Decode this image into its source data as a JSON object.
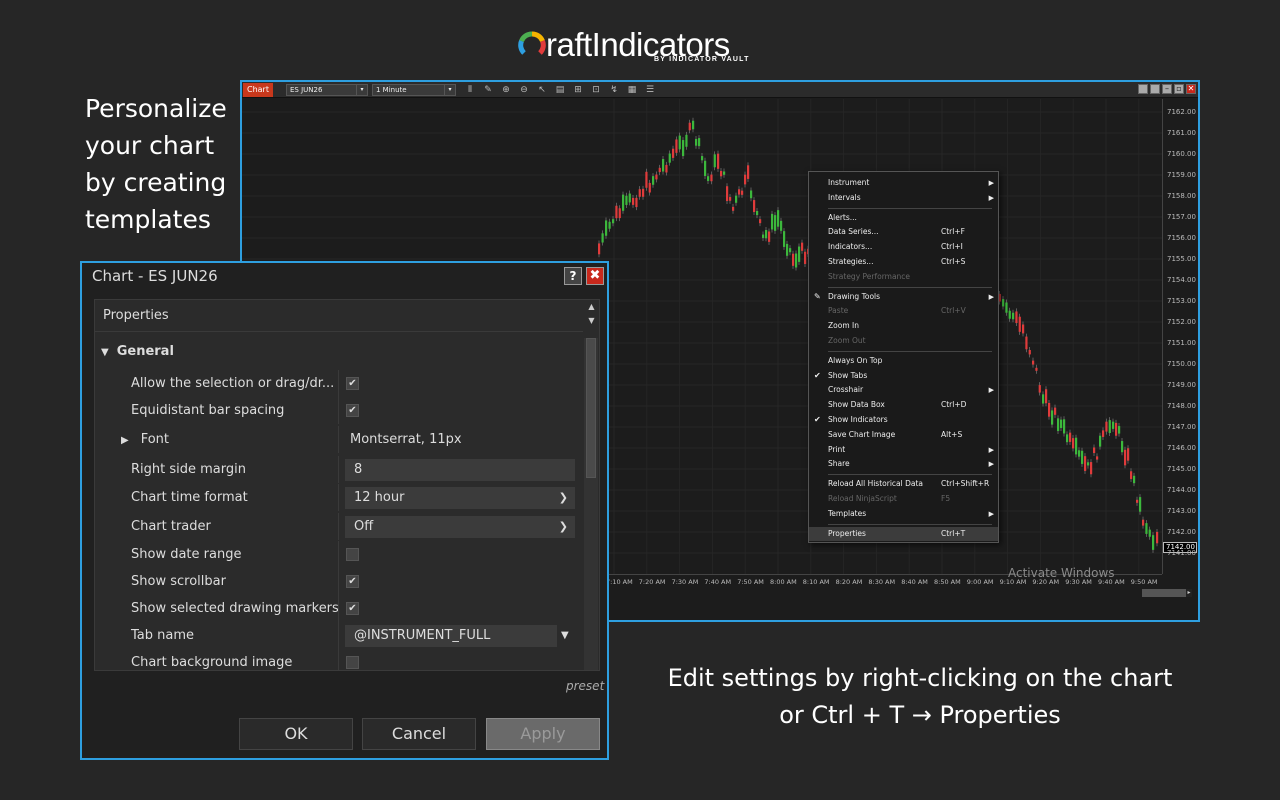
{
  "logo": {
    "text": "raftIndicators",
    "sub": "BY INDICATOR VAULT"
  },
  "captions": {
    "left": [
      "Personalize",
      "your chart",
      "by creating",
      "templates"
    ],
    "right_line1": "Edit settings by right-clicking on the chart",
    "right_line2": "or Ctrl + T → Properties"
  },
  "chart": {
    "tab_label": "Chart",
    "instrument": "ES JUN26",
    "interval": "1 Minute",
    "prices": [
      "7162.00",
      "7161.00",
      "7160.00",
      "7159.00",
      "7158.00",
      "7157.00",
      "7156.00",
      "7155.00",
      "7154.00",
      "7153.00",
      "7152.00",
      "7151.00",
      "7150.00",
      "7149.00",
      "7148.00",
      "7147.00",
      "7146.00",
      "7145.00",
      "7144.00",
      "7143.00",
      "7142.00",
      "7141.00"
    ],
    "current_price": "7142.00",
    "times": [
      "7:10 AM",
      "7:20 AM",
      "7:30 AM",
      "7:40 AM",
      "7:50 AM",
      "8:00 AM",
      "8:10 AM",
      "8:20 AM",
      "8:30 AM",
      "8:40 AM",
      "8:50 AM",
      "9:00 AM",
      "9:10 AM",
      "9:20 AM",
      "9:30 AM",
      "9:40 AM",
      "9:50 AM"
    ],
    "watermark": "Activate Windows",
    "colors": {
      "up": "#3cb83c",
      "down": "#e03b3b",
      "accent": "#2e9fe0"
    }
  },
  "context_menu": {
    "items": [
      {
        "label": "Instrument",
        "submenu": true
      },
      {
        "label": "Intervals",
        "submenu": true
      },
      {
        "sep": true
      },
      {
        "label": "Alerts..."
      },
      {
        "label": "Data Series...",
        "shortcut": "Ctrl+F"
      },
      {
        "label": "Indicators...",
        "shortcut": "Ctrl+I"
      },
      {
        "label": "Strategies...",
        "shortcut": "Ctrl+S"
      },
      {
        "label": "Strategy Performance",
        "disabled": true
      },
      {
        "sep": true
      },
      {
        "label": "Drawing Tools",
        "submenu": true,
        "icon": "pencil-icon"
      },
      {
        "label": "Paste",
        "shortcut": "Ctrl+V",
        "disabled": true
      },
      {
        "label": "Zoom In"
      },
      {
        "label": "Zoom Out",
        "disabled": true
      },
      {
        "sep": true
      },
      {
        "label": "Always On Top"
      },
      {
        "label": "Show Tabs",
        "checked": true
      },
      {
        "label": "Crosshair",
        "submenu": true
      },
      {
        "label": "Show Data Box",
        "shortcut": "Ctrl+D"
      },
      {
        "label": "Show Indicators",
        "checked": true
      },
      {
        "label": "Save Chart Image",
        "shortcut": "Alt+S"
      },
      {
        "label": "Print",
        "submenu": true
      },
      {
        "label": "Share",
        "submenu": true
      },
      {
        "sep": true
      },
      {
        "label": "Reload All Historical Data",
        "shortcut": "Ctrl+Shift+R"
      },
      {
        "label": "Reload NinjaScript",
        "shortcut": "F5",
        "disabled": true
      },
      {
        "label": "Templates",
        "submenu": true
      },
      {
        "sep": true
      },
      {
        "label": "Properties",
        "shortcut": "Ctrl+T",
        "selected": true
      }
    ]
  },
  "dialog": {
    "title": "Chart - ES JUN26",
    "help": "?",
    "close": "✖",
    "header": "Properties",
    "category": "General",
    "rows": {
      "allow_selection": "Allow the selection or drag/dr...",
      "equidistant": "Equidistant bar spacing",
      "font": "Font",
      "font_value": "Montserrat, 11px",
      "right_margin": "Right side margin",
      "right_margin_value": "8",
      "time_format": "Chart time format",
      "time_format_value": "12 hour",
      "chart_trader": "Chart trader",
      "chart_trader_value": "Off",
      "date_range": "Show date range",
      "scrollbar": "Show scrollbar",
      "drawing_markers": "Show selected drawing markers",
      "tab_name": "Tab name",
      "tab_name_value": "@INSTRUMENT_FULL",
      "bg_image": "Chart background image"
    },
    "checks": {
      "allow_selection": true,
      "equidistant": true,
      "date_range": false,
      "scrollbar": true,
      "drawing_markers": true,
      "bg_image": false
    },
    "preset": "preset",
    "ok": "OK",
    "cancel": "Cancel",
    "apply": "Apply"
  }
}
